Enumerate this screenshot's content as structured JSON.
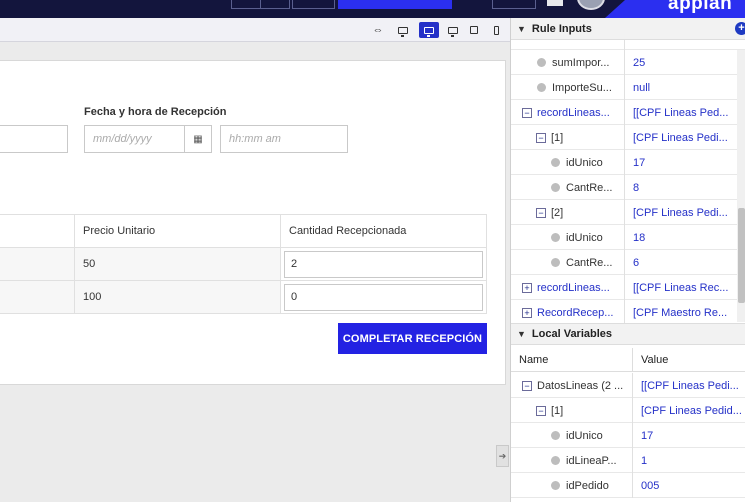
{
  "header": {
    "logo_text": "appian",
    "colors": {
      "bar": "#13153d",
      "accent": "#2b2ff0"
    }
  },
  "device_bar": {
    "icons": [
      "fit-width-icon",
      "desktop-icon",
      "desktop-wide-icon",
      "laptop-icon",
      "tablet-icon",
      "phone-icon"
    ],
    "active": "desktop-wide-icon"
  },
  "form": {
    "reception_label": "Fecha y hora de Recepción",
    "date_placeholder": "mm/dd/yyyy",
    "time_placeholder": "hh:mm am",
    "grid": {
      "headers": [
        "Precio Unitario",
        "Cantidad Recepcionada"
      ],
      "rows": [
        {
          "precio": "50",
          "cantidad": "2"
        },
        {
          "precio": "100",
          "cantidad": "0"
        }
      ]
    },
    "complete_button": "COMPLETAR RECEPCIÓN",
    "button_color": "#2322e3"
  },
  "rule_inputs": {
    "title": "Rule Inputs",
    "rows": [
      {
        "name": "sumImpor...",
        "value": "25",
        "kind": "leaf"
      },
      {
        "name": "ImporteSu...",
        "value": "null",
        "kind": "leaf"
      },
      {
        "name": "recordLineas...",
        "value": "[[CPF Lineas Ped...",
        "kind": "minus"
      },
      {
        "name": "[1]",
        "value": "[CPF Lineas Pedi...",
        "kind": "minus"
      },
      {
        "name": "idUnico",
        "value": "17",
        "kind": "leaf"
      },
      {
        "name": "CantRe...",
        "value": "8",
        "kind": "leaf"
      },
      {
        "name": "[2]",
        "value": "[CPF Lineas Pedi...",
        "kind": "minus"
      },
      {
        "name": "idUnico",
        "value": "18",
        "kind": "leaf"
      },
      {
        "name": "CantRe...",
        "value": "6",
        "kind": "leaf"
      },
      {
        "name": "recordLineas...",
        "value": "[[CPF Lineas Rec...",
        "kind": "plus"
      },
      {
        "name": "RecordRecep...",
        "value": "[CPF Maestro Re...",
        "kind": "plus"
      }
    ]
  },
  "local_variables": {
    "title": "Local Variables",
    "col_name": "Name",
    "col_value": "Value",
    "rows": [
      {
        "name": "DatosLineas (2 ...",
        "value": "[[CPF Lineas Pedi...",
        "kind": "minus"
      },
      {
        "name": "[1]",
        "value": "[CPF Lineas Pedid...",
        "kind": "minus"
      },
      {
        "name": "idUnico",
        "value": "17",
        "kind": "leaf"
      },
      {
        "name": "idLineaP...",
        "value": "1",
        "kind": "leaf"
      },
      {
        "name": "idPedido",
        "value": "005",
        "kind": "leaf"
      }
    ]
  }
}
